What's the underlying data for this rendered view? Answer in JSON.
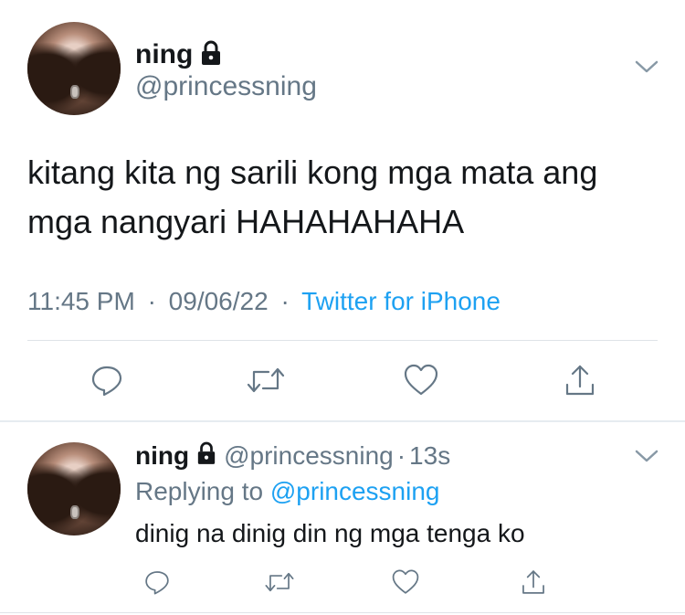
{
  "main_tweet": {
    "display_name": "ning",
    "handle": "@princessning",
    "text_line1": "kitang kita ng sarili kong mga mata ang",
    "text_line2": "mga nangyari HAHAHAHAHA",
    "time": "11:45 PM",
    "date": "09/06/22",
    "separator": "·",
    "source": "Twitter for iPhone",
    "icons": [
      "lock-icon",
      "chevron-down-icon",
      "reply-icon",
      "retweet-icon",
      "like-icon",
      "share-icon"
    ]
  },
  "reply_tweet": {
    "display_name": "ning",
    "handle": "@princessning",
    "dot": "·",
    "age": "13s",
    "replying_prefix": "Replying to",
    "replying_handle": "@princessning",
    "text": "dinig na dinig din ng mga tenga ko",
    "icons": [
      "lock-icon",
      "chevron-down-icon",
      "reply-icon",
      "retweet-icon",
      "like-icon",
      "share-icon"
    ]
  },
  "colors": {
    "accent": "#1da1f2",
    "muted": "#657786",
    "text": "#14171a",
    "divider": "#dfe3e8"
  }
}
